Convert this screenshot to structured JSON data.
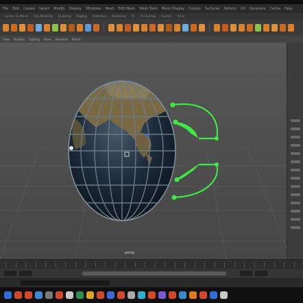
{
  "app": {
    "menu": [
      "File",
      "Edit",
      "Create",
      "Select",
      "Modify",
      "Display",
      "Windows",
      "Mesh",
      "Edit Mesh",
      "Mesh Tools",
      "Mesh Display",
      "Curves",
      "Surfaces",
      "Deform",
      "UV",
      "Generate",
      "Cache",
      "Help"
    ],
    "shelf_tabs": [
      "Curves / Surfaces",
      "Poly Modeling",
      "Sculpting",
      "Rigging",
      "Animation",
      "Rendering",
      "FX",
      "FX Caching",
      "Custom",
      "XGen"
    ],
    "panel_menu": [
      "View",
      "Shading",
      "Lighting",
      "Show",
      "Renderer",
      "Panels"
    ],
    "viewport_label": "persp"
  },
  "colors": {
    "toolbar_icons": [
      "#d9822b",
      "#cc6a22",
      "#e0903a",
      "#c45a1e",
      "#6fa8dc",
      "#d9822b",
      "#8bc34a",
      "#e0903a",
      "#b35a1a",
      "#d9822b",
      "#5b9bd5",
      "#cc6a22",
      "#e0903a",
      "#d9822b",
      "#c45a1e",
      "#e0903a",
      "#d9822b",
      "#cc6a22",
      "#e0903a",
      "#b35a1a",
      "#d9822b",
      "#6fa8dc",
      "#cc6a22",
      "#e0903a",
      "#d9822b",
      "#c45a1e",
      "#e0903a",
      "#d9822b",
      "#cc6a22",
      "#8bc34a",
      "#d9822b",
      "#e0903a",
      "#cc6a22",
      "#d9822b"
    ],
    "taskbar_icons": [
      "#2f6fd6",
      "#d04a2a",
      "#d04a2a",
      "#3a8ad0",
      "#7a7a7a",
      "#d04a2a",
      "#c9c9c9",
      "#2f8f4e",
      "#e0a020",
      "#d04a2a",
      "#3a6ad0",
      "#d04a2a",
      "#aaaaaa",
      "#2fb0d0",
      "#d04a2a",
      "#7a5ad0",
      "#d04a2a",
      "#3a8ad0",
      "#e07a20",
      "#d04a2a",
      "#2f6fd6",
      "#c9c9c9"
    ],
    "control_green": "#3ee845",
    "globe_wire": "#6a7a88"
  }
}
